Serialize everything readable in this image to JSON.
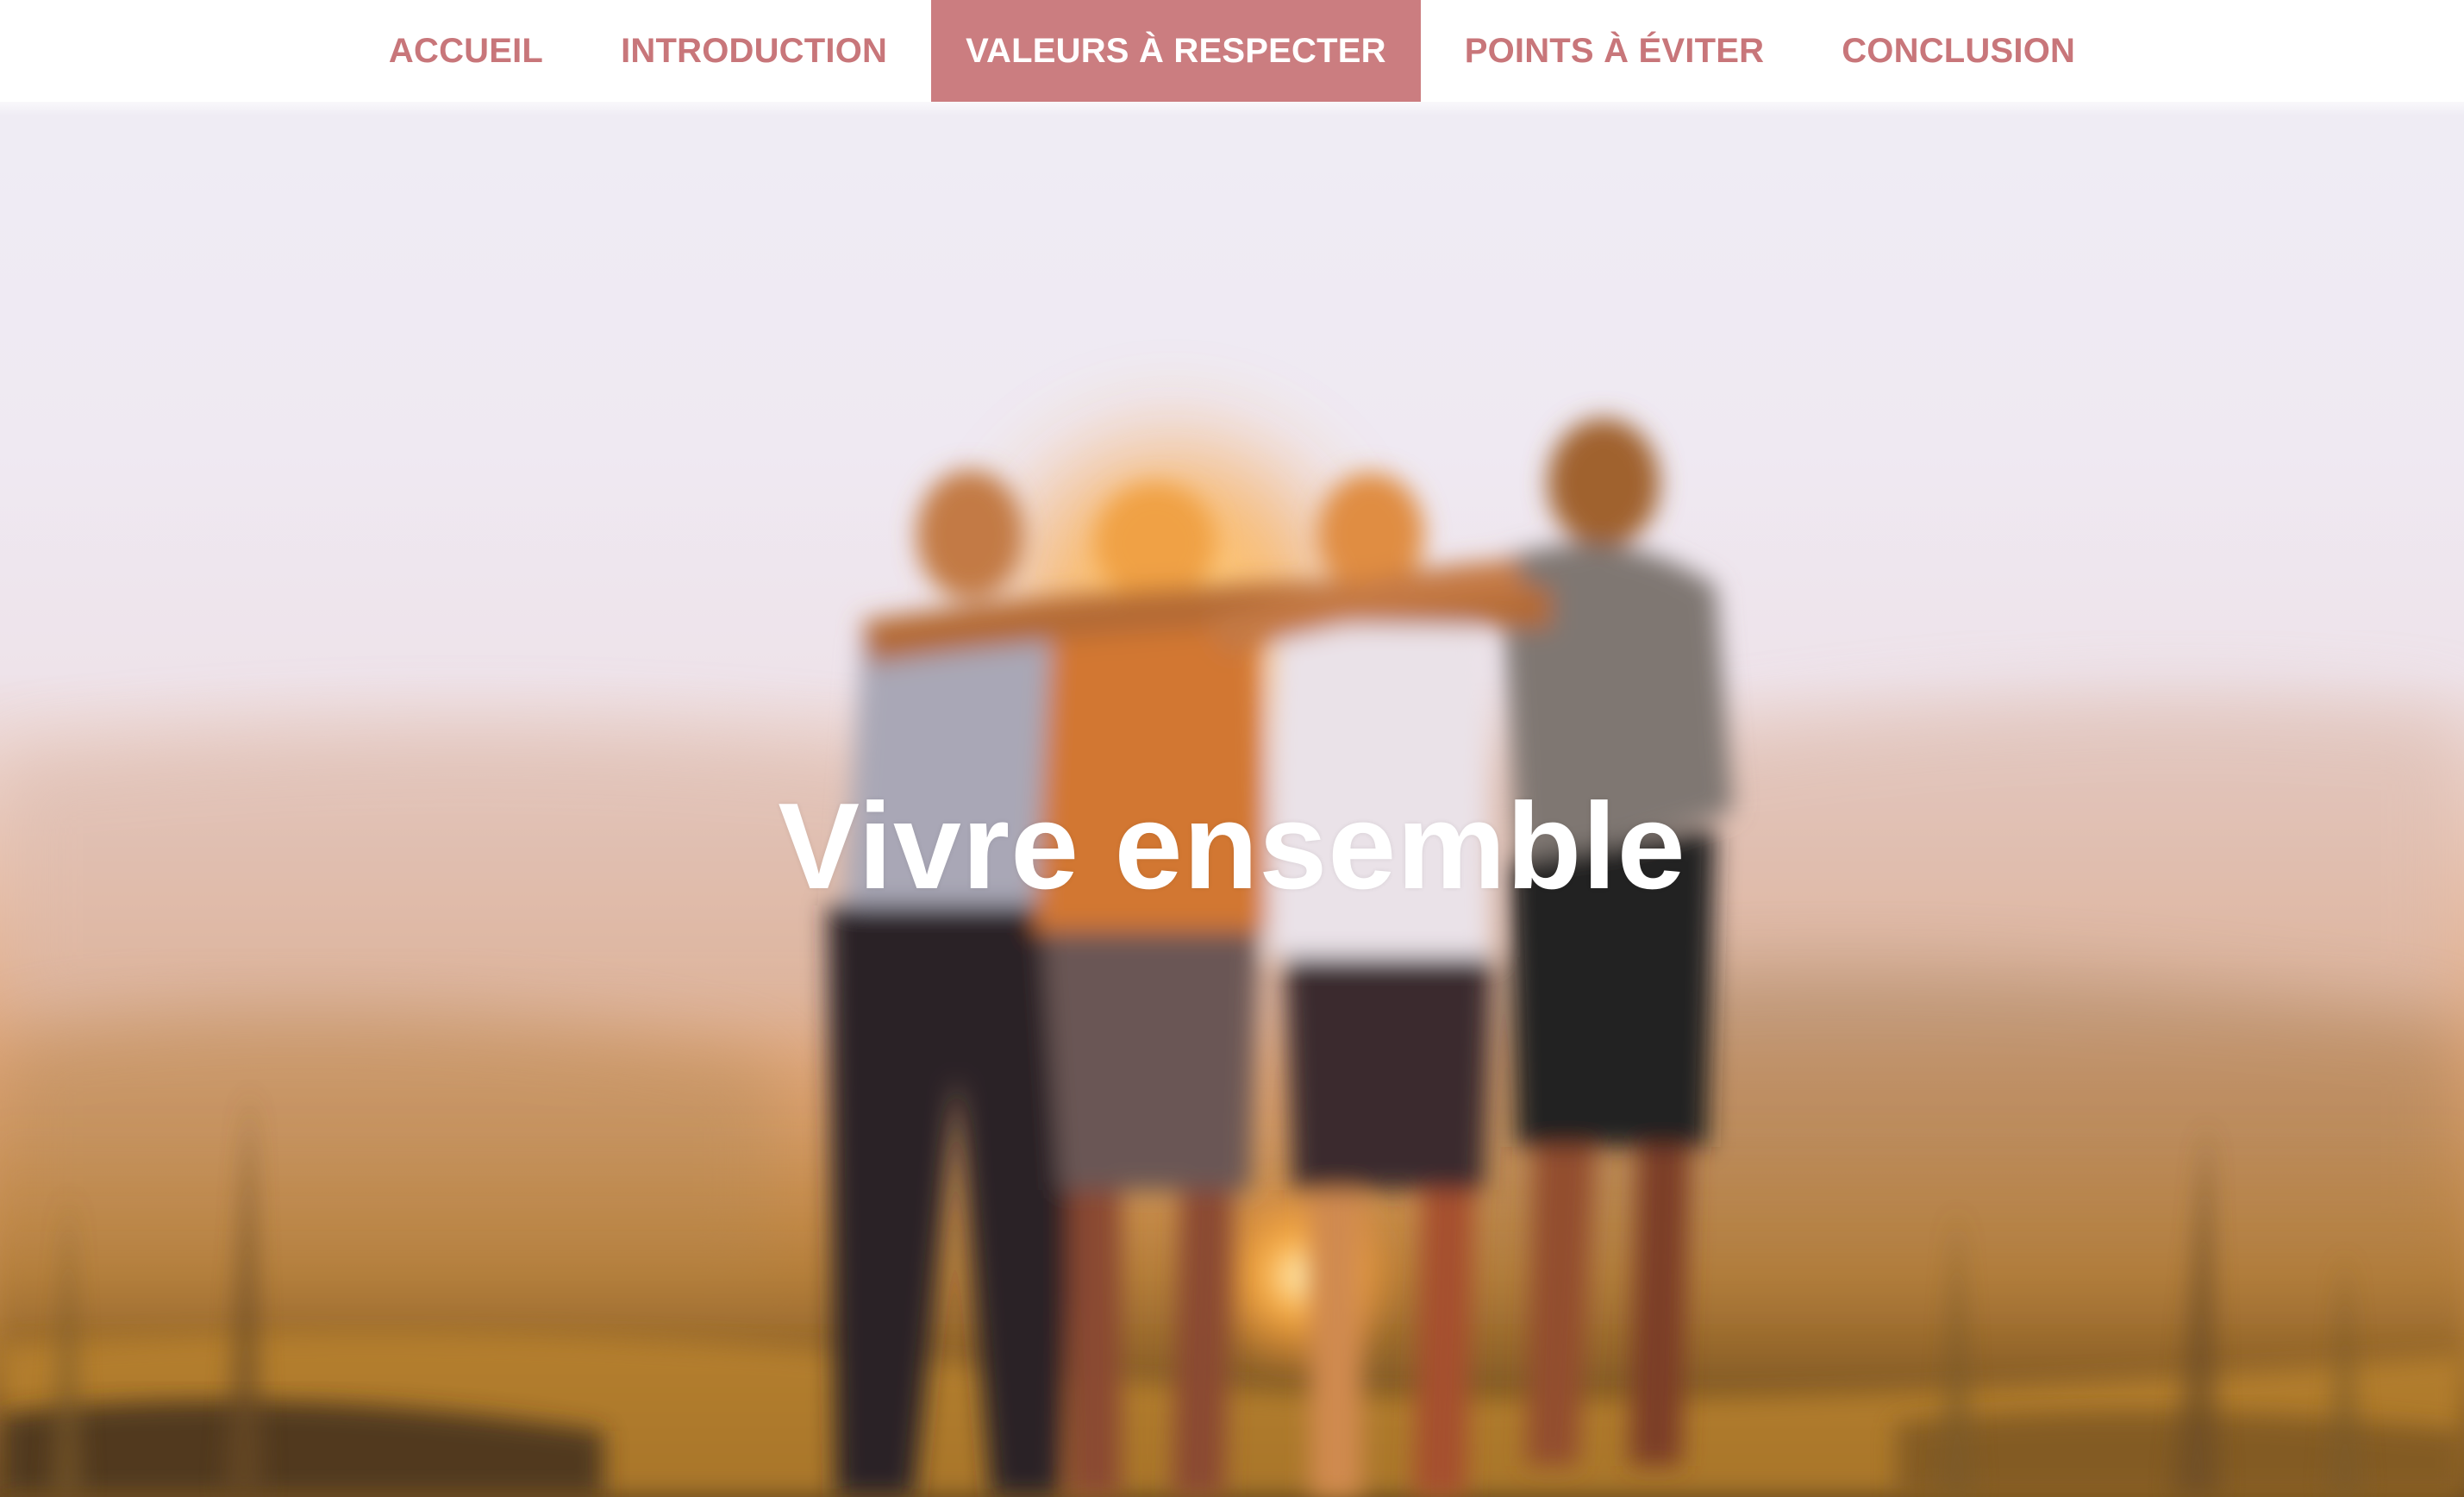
{
  "nav": {
    "items": [
      {
        "label": "ACCUEIL",
        "active": false
      },
      {
        "label": "INTRODUCTION",
        "active": false
      },
      {
        "label": "VALEURS À RESPECTER",
        "active": true
      },
      {
        "label": "POINTS À ÉVITER",
        "active": false
      },
      {
        "label": "CONCLUSION",
        "active": false
      }
    ]
  },
  "hero": {
    "title": "Vivre ensemble",
    "image": "blurred photo of four friends embracing at sunset on a hilltop"
  },
  "colors": {
    "accent": "#cb7d80",
    "nav_text": "#c8767a",
    "title_text": "#ffffff"
  }
}
